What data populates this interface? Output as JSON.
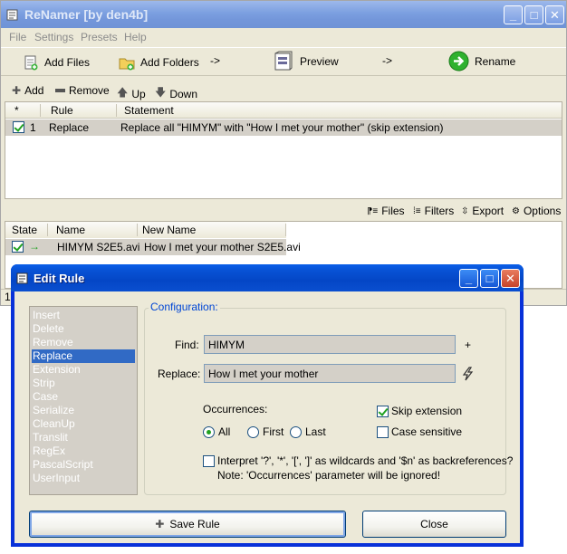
{
  "main_window": {
    "title": "ReNamer  [by den4b]",
    "menu": [
      "File",
      "Settings",
      "Presets",
      "Help"
    ],
    "toolbar": {
      "add_files": "Add Files",
      "add_folders": "Add Folders",
      "arrow1": "->",
      "preview": "Preview",
      "arrow2": "->",
      "rename": "Rename"
    },
    "rules_toolbar": {
      "add": "Add",
      "remove": "Remove",
      "up": "Up",
      "down": "Down"
    },
    "rules_table": {
      "columns": [
        "*",
        "Rule",
        "Statement"
      ],
      "rows": [
        {
          "checked": true,
          "index": "1",
          "rule": "Replace",
          "statement": "Replace all \"HIMYM\" with \"How I met your mother\" (skip extension)"
        }
      ]
    },
    "files_toolbar": {
      "files": "Files",
      "filters": "Filters",
      "export": "Export",
      "options": "Options"
    },
    "files_table": {
      "columns": [
        "State",
        "Name",
        "New Name"
      ],
      "rows": [
        {
          "checked": true,
          "name": "HIMYM S2E5.avi",
          "new_name": "How I met your mother S2E5.avi"
        }
      ]
    },
    "status_fragment": "1"
  },
  "dialog": {
    "title": "Edit Rule",
    "rule_types": [
      "Insert",
      "Delete",
      "Remove",
      "Replace",
      "Extension",
      "Strip",
      "Case",
      "Serialize",
      "CleanUp",
      "Translit",
      "RegEx",
      "PascalScript",
      "UserInput"
    ],
    "selected_rule": "Replace",
    "config": {
      "legend": "Configuration:",
      "find_label": "Find:",
      "find_value": "HIMYM",
      "find_plus": "+",
      "replace_label": "Replace:",
      "replace_value": "How I met your mother",
      "occurrences_label": "Occurrences:",
      "occurrences": {
        "all": "All",
        "first": "First",
        "last": "Last",
        "selected": "All"
      },
      "skip_extension": {
        "label": "Skip extension",
        "checked": true
      },
      "case_sensitive": {
        "label": "Case sensitive",
        "checked": false
      },
      "interpret": {
        "label": "Interpret '?', '*', '[', ']' as wildcards and '$n' as backreferences?",
        "checked": false
      },
      "note": "Note: 'Occurrences' parameter will be ignored!"
    },
    "save_button": "Save Rule",
    "close_button": "Close"
  },
  "colors": {
    "xp_blue": "#0831d9",
    "selection": "#316ac5",
    "face": "#ece9d8"
  }
}
